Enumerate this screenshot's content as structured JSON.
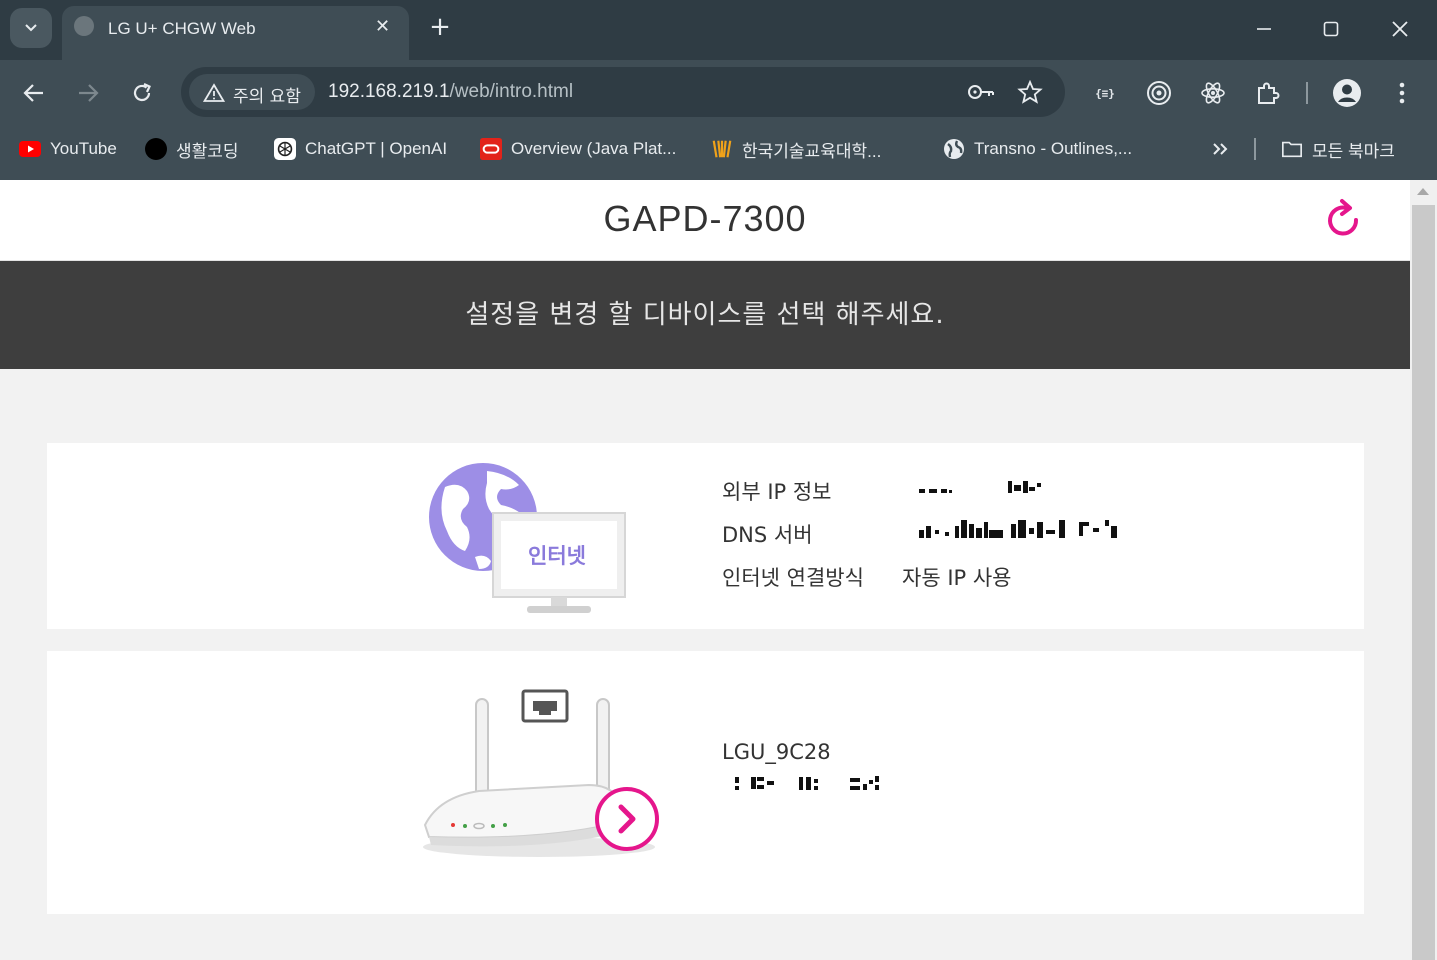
{
  "browser": {
    "tab": {
      "title": "LG U+ CHGW Web"
    },
    "omnibox": {
      "security_chip": "주의 요함",
      "url_host": "192.168.219.1",
      "url_path": "/web/intro.html"
    },
    "bookmarks": [
      {
        "label": "YouTube",
        "icon": "youtube-icon"
      },
      {
        "label": "생활코딩",
        "icon": "circle-icon"
      },
      {
        "label": "ChatGPT | OpenAI",
        "icon": "openai-icon"
      },
      {
        "label": "Overview (Java Plat...",
        "icon": "oracle-icon"
      },
      {
        "label": "한국기술교육대학...",
        "icon": "koreatech-icon"
      },
      {
        "label": "Transno - Outlines,...",
        "icon": "globe-icon"
      }
    ],
    "all_bookmarks_label": "모든 북마크"
  },
  "page": {
    "title": "GAPD-7300",
    "banner": "설정을 변경 할 디바이스를 선택 해주세요.",
    "internet_card": {
      "icon_label": "인터넷",
      "rows": [
        {
          "label": "외부 IP 정보",
          "value": ""
        },
        {
          "label": "DNS 서버",
          "value": ""
        },
        {
          "label": "인터넷 연결방식",
          "value": "자동 IP 사용"
        }
      ]
    },
    "device_card": {
      "ssid": "LGU_9C28"
    }
  },
  "colors": {
    "accent_pink": "#e5168c",
    "banner_bg": "#3e3e3e",
    "chrome_dark": "#2f3c44",
    "chrome_toolbar": "#3f4d55",
    "globe_purple": "#9d8ee6"
  }
}
